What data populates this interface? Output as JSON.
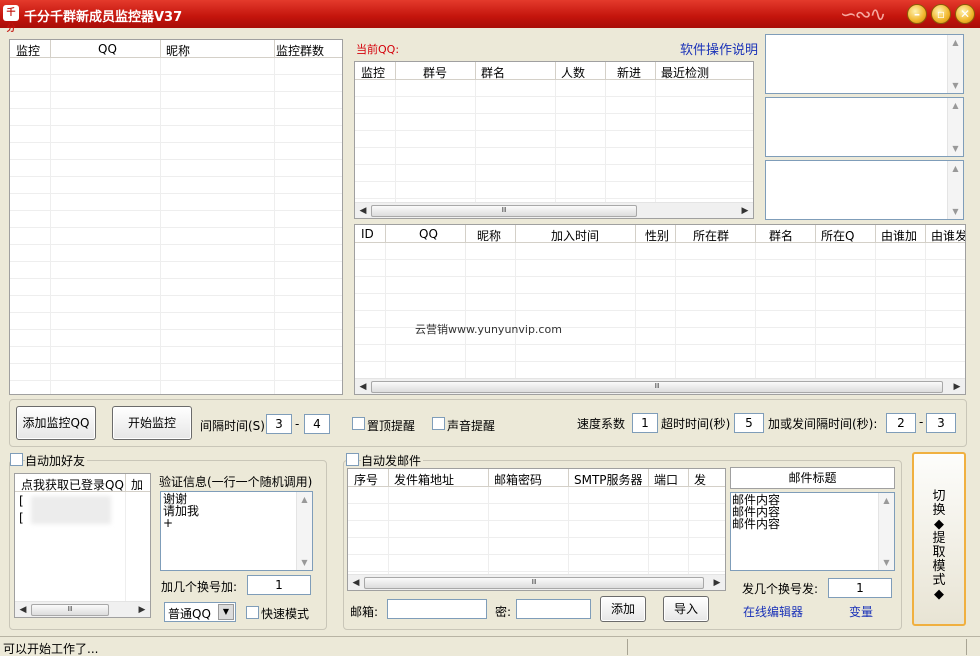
{
  "window": {
    "title": "千分千群新成员监控器V37",
    "logo_text": "千分",
    "controls": [
      "minimize-icon",
      "maximize-icon",
      "close-icon"
    ],
    "accent": "#c3140c"
  },
  "monitor_list": {
    "columns": [
      "监控",
      "QQ",
      "昵称",
      "监控群数"
    ]
  },
  "current_qq": {
    "label": "当前QQ:",
    "help_link": "软件操作说明"
  },
  "group_table": {
    "columns": [
      "监控",
      "群号",
      "群名",
      "人数",
      "新进",
      "最近检测"
    ],
    "scroll_thumb": "Ⅲ"
  },
  "member_table": {
    "columns": [
      "ID",
      "QQ",
      "昵称",
      "加入时间",
      "性别",
      "所在群",
      "群名",
      "所在Q",
      "由谁加",
      "由谁发"
    ],
    "watermark": "云营销www.yunyunvip.com",
    "scroll_thumb": "Ⅲ"
  },
  "toolbar": {
    "add_monitor": "添加监控QQ",
    "start_monitor": "开始监控",
    "interval_label": "间隔时间(S)",
    "interval_from": "3",
    "dash": "-",
    "interval_to": "4",
    "pin_alert": "置顶提醒",
    "sound_alert": "声音提醒",
    "speed_label": "速度系数",
    "speed_value": "1",
    "timeout_label": "超时时间(秒)",
    "timeout_value": "5",
    "send_interval_label": "加或发间隔时间(秒):",
    "send_from": "2",
    "send_to": "3"
  },
  "auto_friend": {
    "title": "自动加好友",
    "list_columns": [
      "点我获取已登录QQ",
      "加"
    ],
    "list_rows": [
      "[",
      "["
    ],
    "verify_label": "验证信息(一行一个随机调用)",
    "verify_lines": [
      "谢谢",
      "请加我",
      "+"
    ],
    "switch_count_label": "加几个换号加:",
    "switch_count_value": "1",
    "qq_type_value": "普通QQ",
    "fast_mode_label": "快速模式"
  },
  "auto_mail": {
    "title": "自动发邮件",
    "columns": [
      "序号",
      "发件箱地址",
      "邮箱密码",
      "SMTP服务器",
      "端口",
      "发"
    ],
    "subject_header": "邮件标题",
    "content_lines": [
      "邮件内容",
      "邮件内容",
      "邮件内容"
    ],
    "send_count_label": "发几个换号发:",
    "send_count_value": "1",
    "email_label": "邮箱:",
    "password_label": "密:",
    "add_button": "添加",
    "import_button": "导入",
    "online_editor": "在线编辑器",
    "variables": "变量"
  },
  "switch_mode_button": "切换◆提取模式◆",
  "status": {
    "text": "可以开始工作了..."
  }
}
